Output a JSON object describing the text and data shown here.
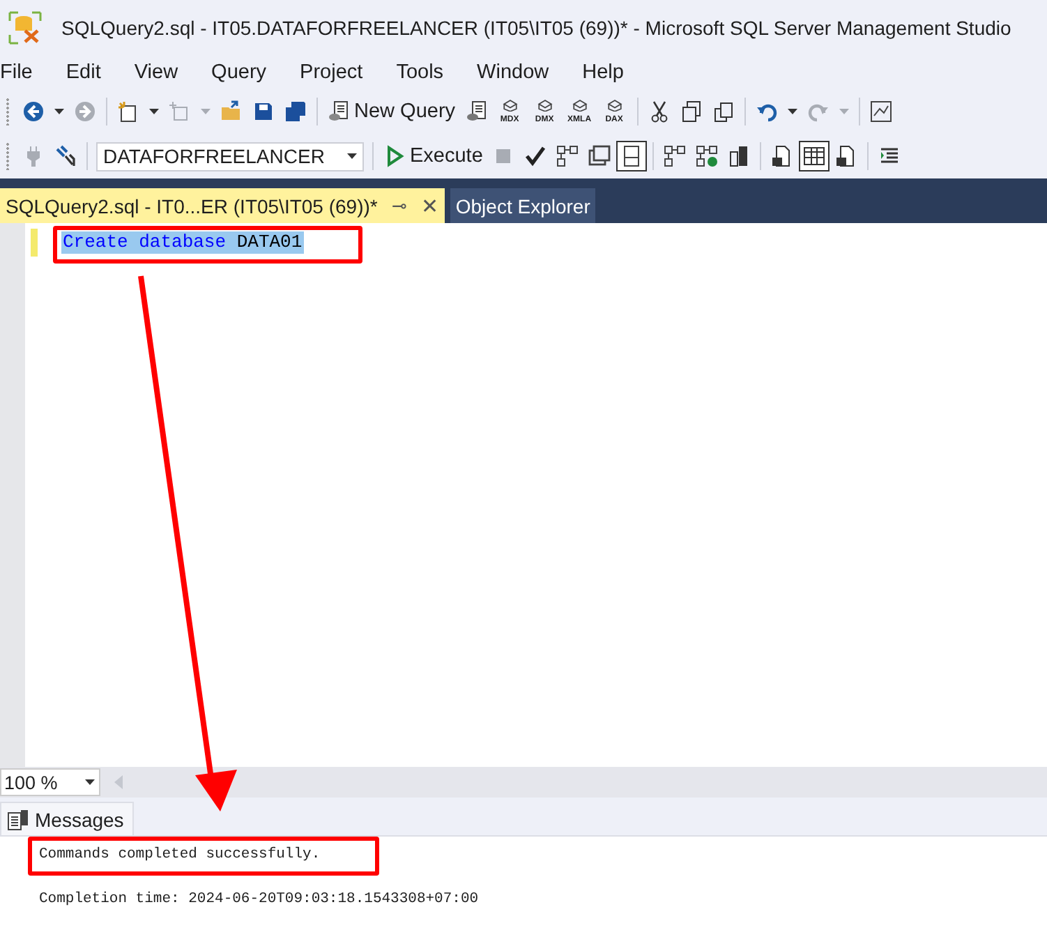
{
  "window": {
    "title": "SQLQuery2.sql - IT05.DATAFORFREELANCER (IT05\\IT05 (69))* - Microsoft SQL Server Management Studio"
  },
  "menu": [
    "File",
    "Edit",
    "View",
    "Query",
    "Project",
    "Tools",
    "Window",
    "Help"
  ],
  "toolbar_standard": [
    {
      "kind": "back",
      "disabled": false
    },
    {
      "kind": "dropdown",
      "disabled": false
    },
    {
      "kind": "forward",
      "disabled": true
    },
    {
      "kind": "separator"
    },
    {
      "kind": "new-project",
      "disabled": false
    },
    {
      "kind": "dropdown",
      "disabled": false
    },
    {
      "kind": "add-item",
      "disabled": true
    },
    {
      "kind": "dropdown",
      "disabled": true
    },
    {
      "kind": "open",
      "disabled": false
    },
    {
      "kind": "save",
      "disabled": false
    },
    {
      "kind": "save-all",
      "disabled": false
    },
    {
      "kind": "separator"
    },
    {
      "kind": "new-query",
      "disabled": false,
      "label": "New Query"
    },
    {
      "kind": "db-query",
      "disabled": false
    },
    {
      "kind": "cube",
      "disabled": false,
      "label": "MDX"
    },
    {
      "kind": "cube",
      "disabled": false,
      "label": "DMX"
    },
    {
      "kind": "cube",
      "disabled": false,
      "label": "XMLA"
    },
    {
      "kind": "cube",
      "disabled": false,
      "label": "DAX"
    },
    {
      "kind": "separator"
    },
    {
      "kind": "cut",
      "disabled": false
    },
    {
      "kind": "copy",
      "disabled": false
    },
    {
      "kind": "paste",
      "disabled": false
    },
    {
      "kind": "separator"
    },
    {
      "kind": "undo",
      "disabled": false
    },
    {
      "kind": "dropdown",
      "disabled": false
    },
    {
      "kind": "redo",
      "disabled": true
    },
    {
      "kind": "dropdown",
      "disabled": true
    },
    {
      "kind": "separator"
    },
    {
      "kind": "report",
      "disabled": false
    }
  ],
  "toolbar_query": [
    {
      "kind": "plug",
      "disabled": true,
      "pressed": false
    },
    {
      "kind": "connect",
      "disabled": false,
      "pressed": false
    },
    {
      "kind": "separator"
    },
    {
      "kind": "database-select",
      "value": "DATAFORFREELANCER"
    },
    {
      "kind": "separator"
    },
    {
      "kind": "execute",
      "disabled": false,
      "pressed": false,
      "label": "Execute"
    },
    {
      "kind": "stop",
      "disabled": true,
      "pressed": false
    },
    {
      "kind": "check",
      "disabled": false,
      "pressed": false
    },
    {
      "kind": "plan",
      "disabled": false,
      "pressed": false
    },
    {
      "kind": "windows",
      "disabled": false,
      "pressed": false
    },
    {
      "kind": "pane",
      "disabled": false,
      "pressed": true
    },
    {
      "kind": "separator"
    },
    {
      "kind": "plan",
      "disabled": false,
      "pressed": false
    },
    {
      "kind": "plan-ok",
      "disabled": false,
      "pressed": false
    },
    {
      "kind": "server",
      "disabled": false,
      "pressed": false
    },
    {
      "kind": "separator"
    },
    {
      "kind": "result-text",
      "disabled": false,
      "pressed": false
    },
    {
      "kind": "result-grid",
      "disabled": false,
      "pressed": true
    },
    {
      "kind": "result-file",
      "disabled": false,
      "pressed": false
    },
    {
      "kind": "separator"
    },
    {
      "kind": "indent",
      "disabled": false,
      "pressed": false
    }
  ],
  "tabs": [
    {
      "label": "SQLQuery2.sql - IT0...ER (IT05\\IT05 (69))*",
      "selected": true,
      "pin": "⊸",
      "close": "✕"
    },
    {
      "label": "Object Explorer",
      "selected": false
    }
  ],
  "editor": {
    "lines": [
      {
        "changed": true,
        "selected": true,
        "tokens": [
          {
            "kind": "keyword",
            "text": "Create database"
          },
          {
            "kind": "identifier",
            "text": "DATA01"
          }
        ]
      }
    ]
  },
  "zoom": {
    "value": "100 %"
  },
  "results": {
    "tab": "Messages",
    "lines": [
      "Commands completed successfully.",
      "Completion time: 2024-06-20T09:03:18.1543308+07:00"
    ]
  }
}
